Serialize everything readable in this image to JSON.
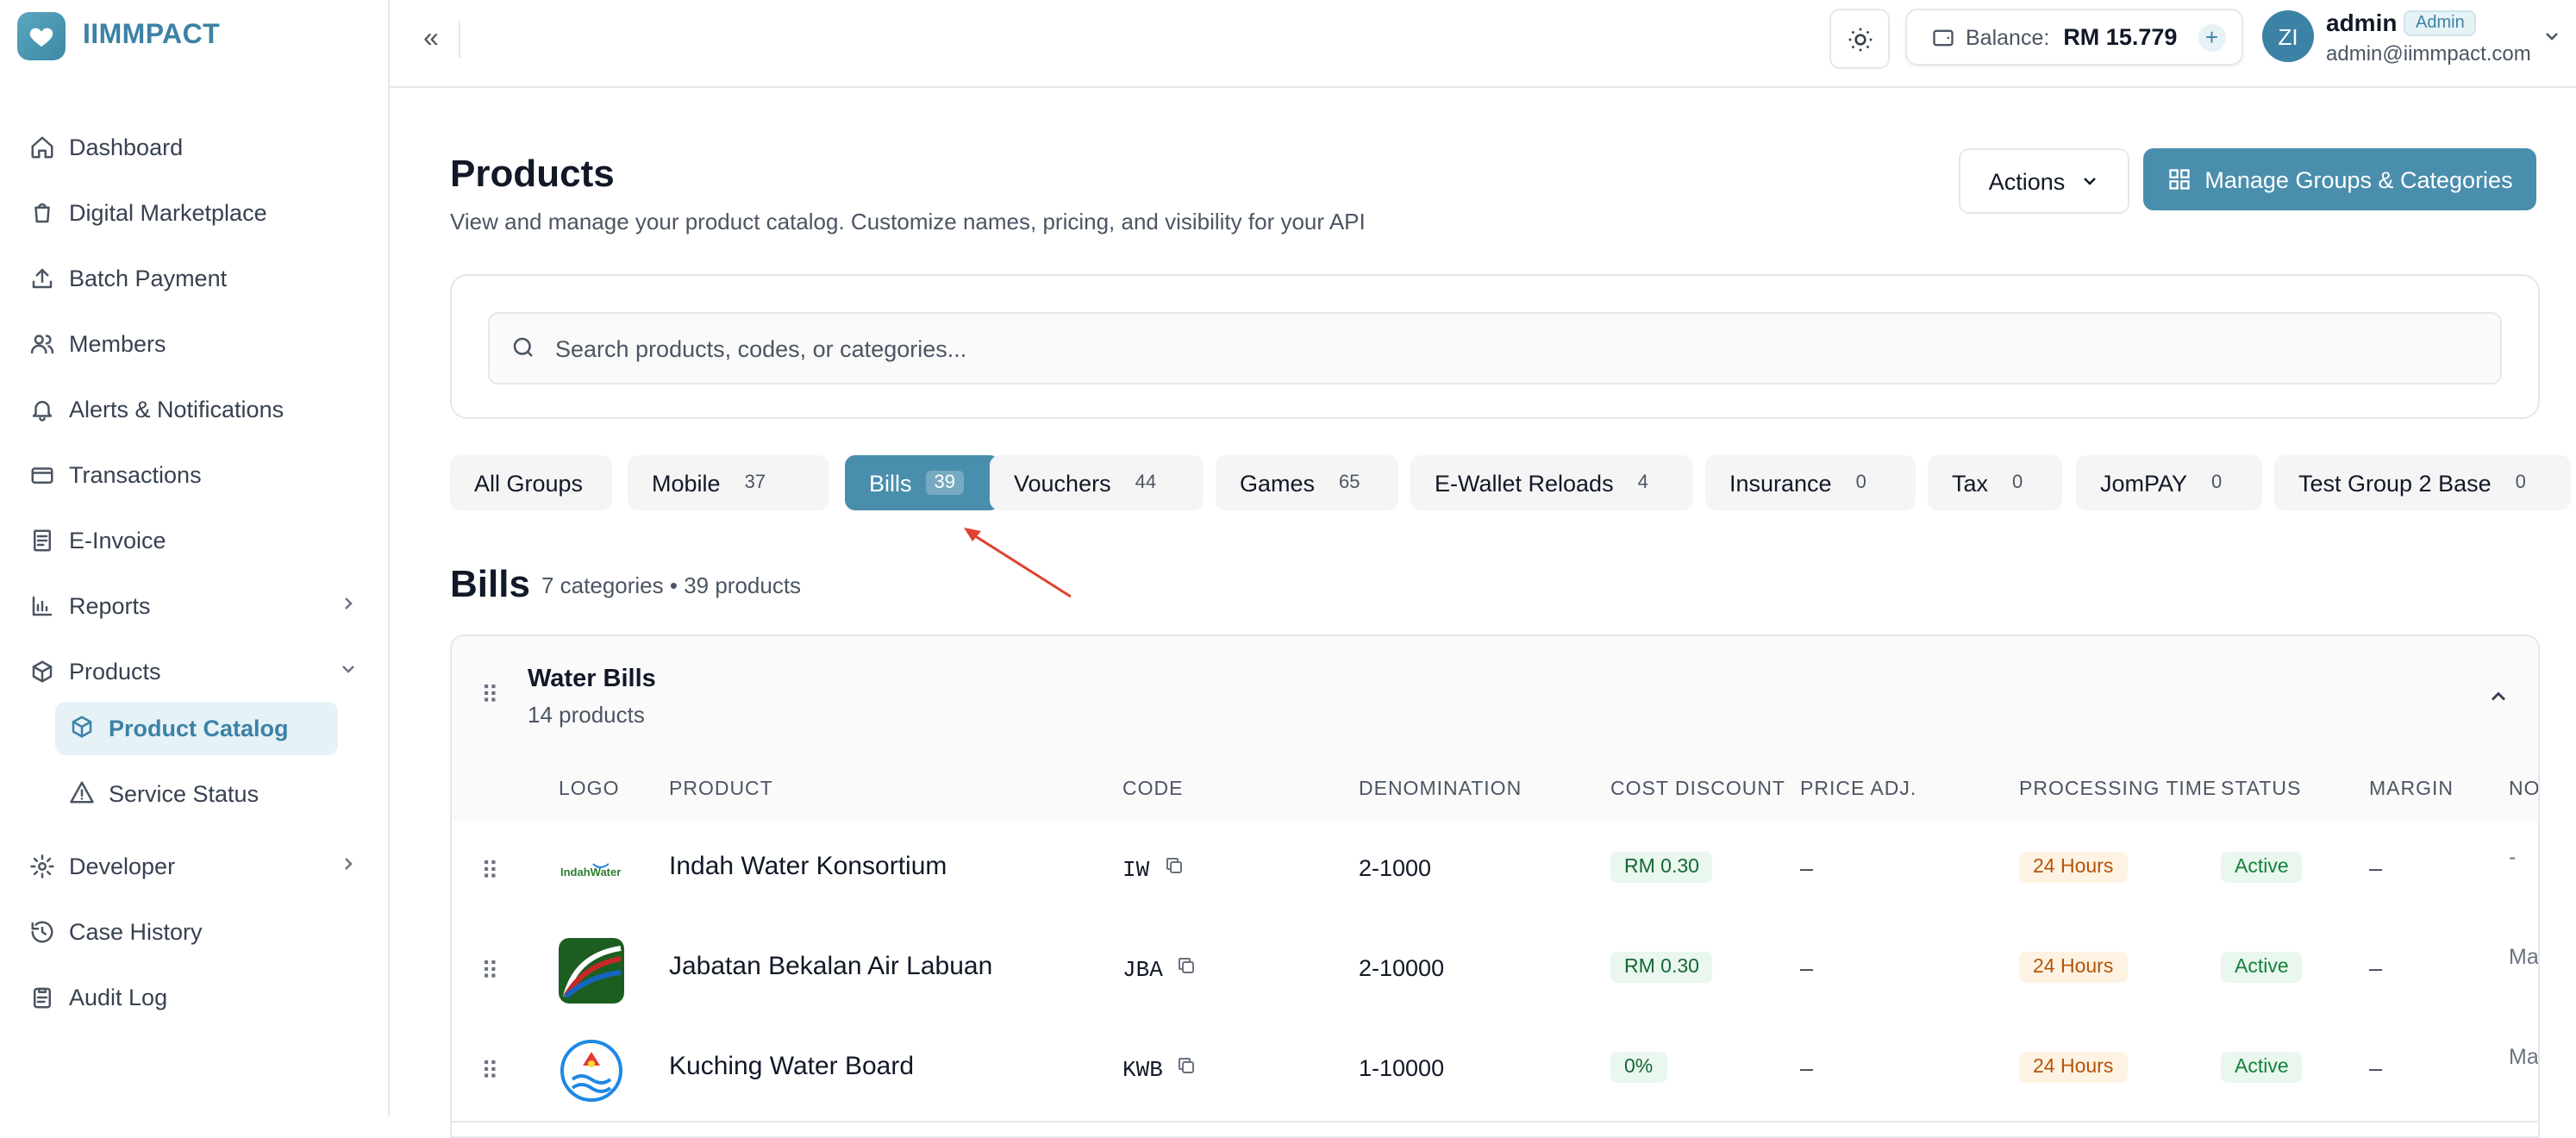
{
  "brand": {
    "name": "IIMMPACT"
  },
  "sidebar": {
    "items": [
      {
        "label": "Dashboard",
        "icon": "home-icon"
      },
      {
        "label": "Digital Marketplace",
        "icon": "shopping-bag-icon"
      },
      {
        "label": "Batch Payment",
        "icon": "upload-icon"
      },
      {
        "label": "Members",
        "icon": "users-icon"
      },
      {
        "label": "Alerts & Notifications",
        "icon": "bell-icon"
      },
      {
        "label": "Transactions",
        "icon": "credit-card-icon"
      },
      {
        "label": "E-Invoice",
        "icon": "receipt-icon"
      },
      {
        "label": "Reports",
        "icon": "bar-chart-icon"
      },
      {
        "label": "Products",
        "icon": "package-icon"
      },
      {
        "label": "Developer",
        "icon": "gear-icon"
      },
      {
        "label": "Case History",
        "icon": "history-icon"
      },
      {
        "label": "Audit Log",
        "icon": "clipboard-icon"
      }
    ],
    "sub_items": [
      {
        "label": "Product Catalog",
        "icon": "package-icon",
        "active": true
      },
      {
        "label": "Service Status",
        "icon": "warning-icon",
        "active": false
      }
    ]
  },
  "topbar": {
    "balance_label": "Balance:",
    "balance_amount": "RM 15.779",
    "balance_add": "+",
    "avatar_initials": "ZI",
    "user_name": "admin",
    "user_role": "Admin",
    "user_email": "admin@iimmpact.com"
  },
  "page": {
    "title": "Products",
    "subtitle": "View and manage your product catalog. Customize names, pricing, and visibility for your API",
    "actions_label": "Actions",
    "manage_label": "Manage Groups & Categories"
  },
  "search": {
    "placeholder": "Search products, codes, or categories..."
  },
  "tabs": [
    {
      "label": "All Groups",
      "count": ""
    },
    {
      "label": "Mobile",
      "count": "37"
    },
    {
      "label": "Bills",
      "count": "39",
      "active": true
    },
    {
      "label": "Vouchers",
      "count": "44"
    },
    {
      "label": "Games",
      "count": "65"
    },
    {
      "label": "E-Wallet Reloads",
      "count": "4"
    },
    {
      "label": "Insurance",
      "count": "0"
    },
    {
      "label": "Tax",
      "count": "0"
    },
    {
      "label": "JomPAY",
      "count": "0"
    },
    {
      "label": "Test Group 2 Base",
      "count": "0"
    }
  ],
  "section": {
    "title": "Bills",
    "meta": "7 categories • 39 products"
  },
  "category": {
    "name": "Water Bills",
    "count": "14 products",
    "columns": [
      "LOGO",
      "PRODUCT",
      "CODE",
      "DENOMINATION",
      "COST DISCOUNT",
      "PRICE ADJ.",
      "PROCESSING TIME",
      "STATUS",
      "MARGIN",
      "NO"
    ],
    "rows": [
      {
        "product": "Indah Water Konsortium",
        "code": "IW",
        "denomination": "2-1000",
        "cost_discount": "RM 0.30",
        "price_adj": "–",
        "processing_time": "24 Hours",
        "status": "Active",
        "margin": "–",
        "note": "-",
        "logo_text": "IndahWater"
      },
      {
        "product": "Jabatan Bekalan Air Labuan",
        "code": "JBA",
        "denomination": "2-10000",
        "cost_discount": "RM 0.30",
        "price_adj": "–",
        "processing_time": "24 Hours",
        "status": "Active",
        "margin": "–",
        "note": "Ma"
      },
      {
        "product": "Kuching Water Board",
        "code": "KWB",
        "denomination": "1-10000",
        "cost_discount": "0%",
        "price_adj": "–",
        "processing_time": "24 Hours",
        "status": "Active",
        "margin": "–",
        "note": "Ma"
      }
    ]
  },
  "colors": {
    "accent": "#4a8ead",
    "brand": "#3b82a6",
    "active_green": "#15803d",
    "time_orange": "#b45309"
  }
}
